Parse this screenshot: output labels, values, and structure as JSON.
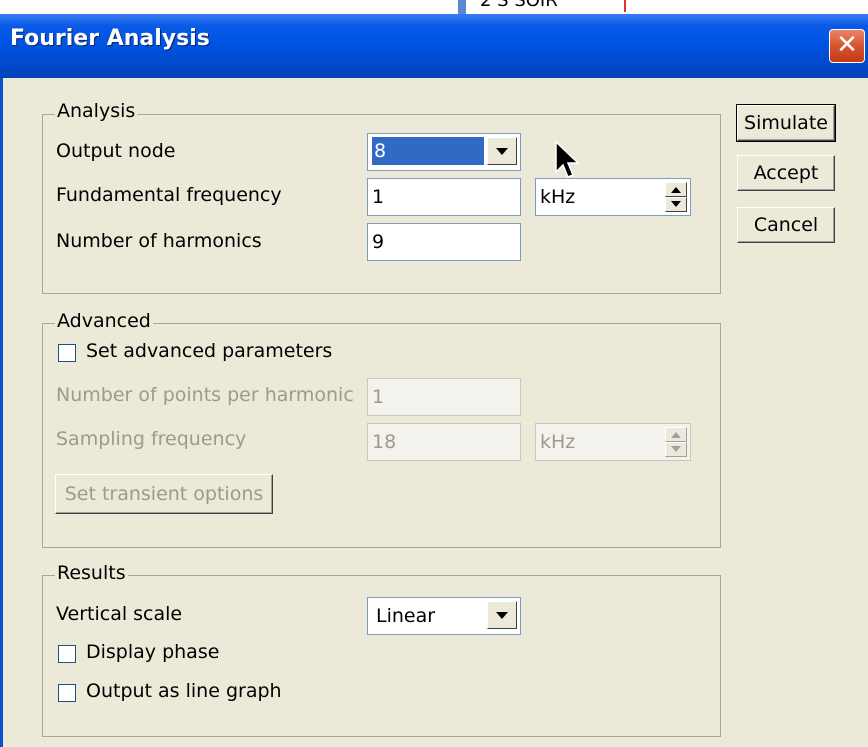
{
  "background_window": {
    "text_fragment": "2 S    SOIR"
  },
  "dialog": {
    "title": "Fourier Analysis",
    "close_glyph": "✕"
  },
  "analysis": {
    "legend": "Analysis",
    "output_node": {
      "label": "Output node",
      "value": "8"
    },
    "fundamental_frequency": {
      "label": "Fundamental frequency",
      "value": "1",
      "unit": "kHz"
    },
    "number_of_harmonics": {
      "label": "Number of harmonics",
      "value": "9"
    }
  },
  "advanced": {
    "legend": "Advanced",
    "set_advanced": {
      "label": "Set advanced parameters",
      "checked": false
    },
    "points_per_harmonic": {
      "label": "Number of points per harmonic",
      "value": "1"
    },
    "sampling_frequency": {
      "label": "Sampling frequency",
      "value": "18",
      "unit": "kHz"
    },
    "transient_button": "Set transient options"
  },
  "results": {
    "legend": "Results",
    "vertical_scale": {
      "label": "Vertical scale",
      "value": "Linear"
    },
    "display_phase": {
      "label": "Display phase",
      "checked": false
    },
    "line_graph": {
      "label": "Output as line graph",
      "checked": false
    }
  },
  "buttons": {
    "simulate": "Simulate",
    "accept": "Accept",
    "cancel": "Cancel"
  },
  "colors": {
    "titlebar": "#0054e3",
    "dialog_bg": "#ece9d8",
    "selection": "#316ac5",
    "close": "#d7542f"
  }
}
